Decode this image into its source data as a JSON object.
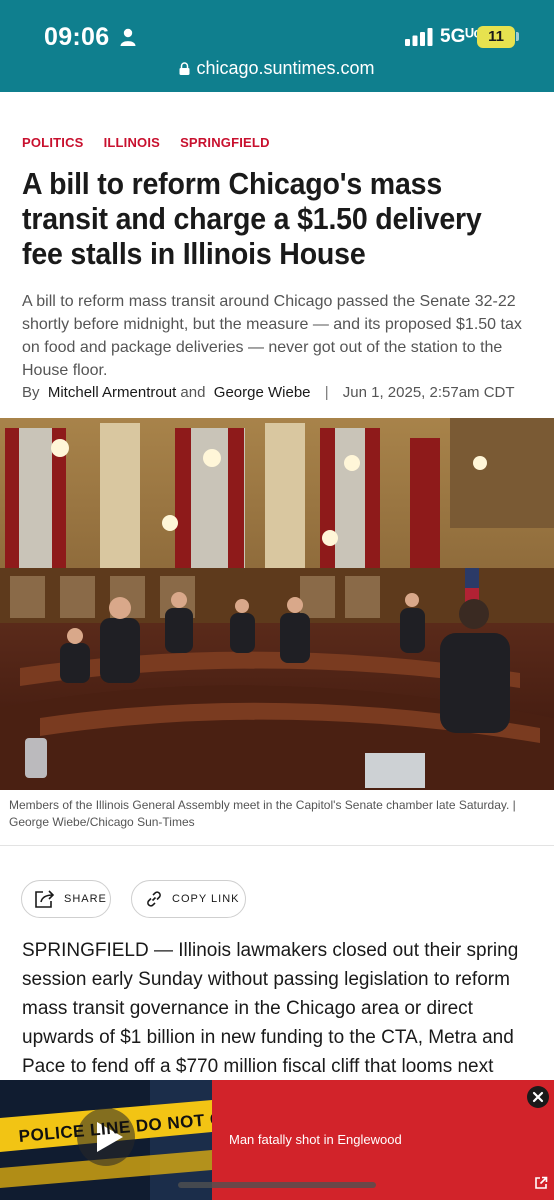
{
  "status_bar": {
    "time": "09:06",
    "network": "5Gᵁᶜ",
    "battery": "11"
  },
  "browser": {
    "url": "chicago.suntimes.com"
  },
  "article": {
    "categories": [
      "POLITICS",
      "ILLINOIS",
      "SPRINGFIELD"
    ],
    "headline": "A bill to reform Chicago's mass transit and charge a $1.50 delivery fee stalls in Illinois House",
    "dek": "A bill to reform mass transit around Chicago passed the Senate 32-22 shortly before midnight, but the measure — and its proposed $1.50 tax on food and package deliveries — never got out of the station to the House floor.",
    "byline": {
      "by": "By",
      "author1": "Mitchell Armentrout",
      "and": "and",
      "author2": "George Wiebe",
      "separator": "|",
      "date": "Jun 1, 2025, 2:57am CDT"
    },
    "caption": "Members of the Illinois General Assembly meet in the Capitol's Senate chamber late Saturday. | George Wiebe/Chicago Sun-Times",
    "share_label": "SHARE",
    "copy_label": "COPY LINK",
    "body": "SPRINGFIELD — Illinois lawmakers closed out their spring session early Sunday without passing legislation to reform mass transit governance in the Chicago area or direct upwards of $1 billion in new funding to the CTA, Metra and Pace to fend off a $770 million fiscal cliff that looms next"
  },
  "video_banner": {
    "title": "Man fatally shot in Englewood",
    "tape_text": "POLICE LINE DO NOT CROSS"
  },
  "icons": [
    "person-icon",
    "signal-icon",
    "lock-icon",
    "share-icon",
    "link-icon",
    "play-icon",
    "close-icon",
    "external-link-icon"
  ],
  "colors": {
    "topbar": "#0f7f8e",
    "accent": "#c8102e",
    "banner": "#d2232a",
    "battery": "#e7e24f"
  }
}
